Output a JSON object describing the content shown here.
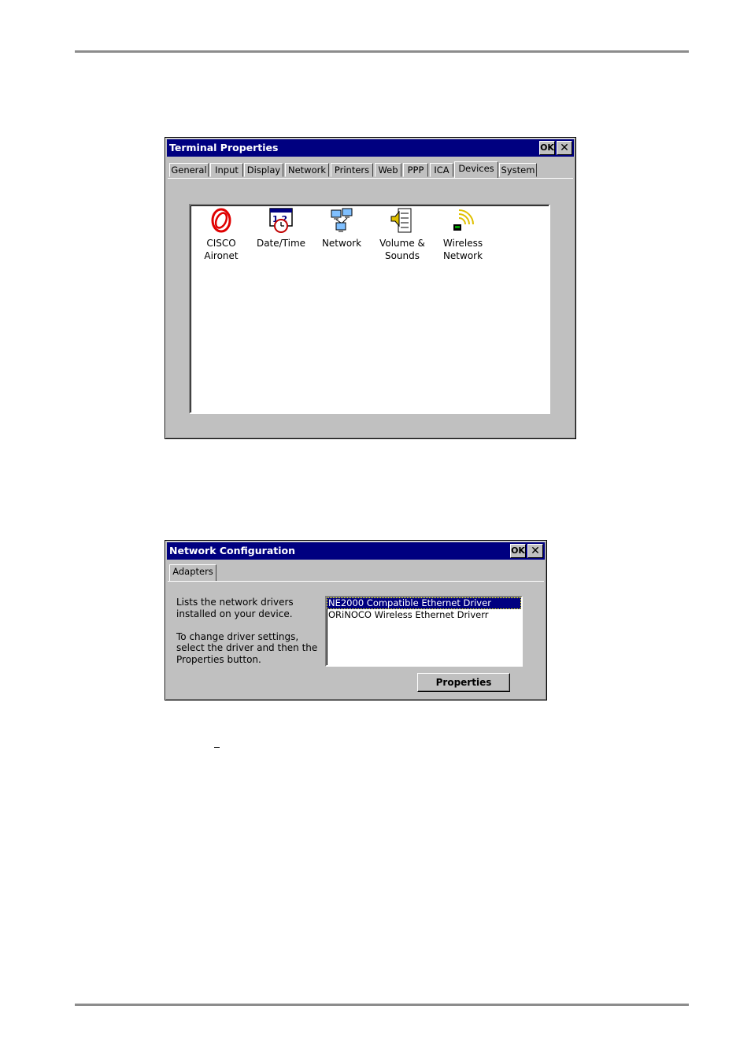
{
  "terminal": {
    "title": "Terminal Properties",
    "ok": "OK",
    "close": "✕",
    "tabs": [
      "General",
      "Input",
      "Display",
      "Network",
      "Printers",
      "Web",
      "PPP",
      "ICA",
      "Devices",
      "System"
    ],
    "active_tab": "Devices",
    "items": [
      {
        "line1": "CISCO",
        "line2": "Aironet",
        "icon": "cisco-aironet-icon"
      },
      {
        "line1": "Date/Time",
        "line2": "",
        "icon": "date-time-icon"
      },
      {
        "line1": "Network",
        "line2": "",
        "icon": "network-icon"
      },
      {
        "line1": "Volume &",
        "line2": "Sounds",
        "icon": "volume-sounds-icon"
      },
      {
        "line1": "Wireless",
        "line2": "Network",
        "icon": "wireless-network-icon"
      }
    ]
  },
  "netconf": {
    "title": "Network Configuration",
    "ok": "OK",
    "close": "✕",
    "tab": "Adapters",
    "desc1a": "Lists the network drivers",
    "desc1b": "installed on your device.",
    "desc2a": "To change driver settings,",
    "desc2b": "select the driver and then the",
    "desc2c": "Properties button.",
    "drivers": [
      "NE2000 Compatible Ethernet Driver",
      "ORiNOCO Wireless Ethernet Driverr"
    ],
    "selected_driver": "NE2000 Compatible Ethernet Driver",
    "properties_button": "Properties"
  }
}
